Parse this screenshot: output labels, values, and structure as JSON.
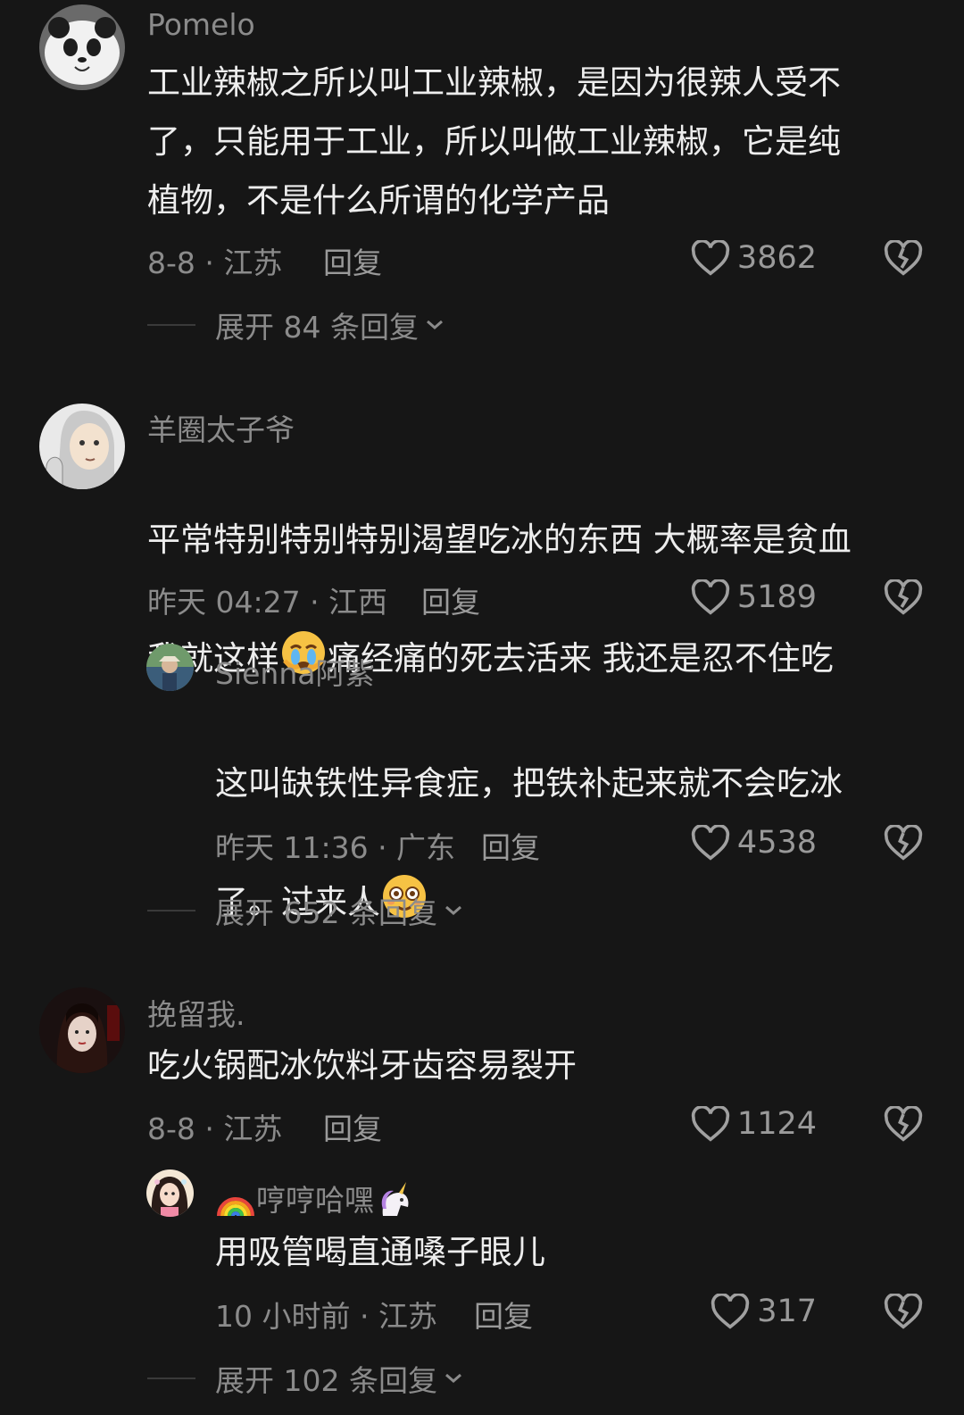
{
  "comments": [
    {
      "username": "Pomelo",
      "text": "工业辣椒之所以叫工业辣椒，是因为很辣人受不\n了，只能用于工业，所以叫做工业辣椒，它是纯\n植物，不是什么所谓的化学产品",
      "meta": "8-8 · 江苏",
      "reply": "回复",
      "likes": "3862",
      "expand": "展开 84 条回复"
    },
    {
      "username": "羊圈太子爷",
      "text_line1": "平常特别特别特别渴望吃冰的东西 大概率是贫血",
      "text_line2a": "我就这样",
      "text_line2b": "痛经痛的死去活来 我还是忍不住吃",
      "meta": "昨天 04:27 · 江西",
      "reply": "回复",
      "likes": "5189",
      "sub": {
        "username": "Sienna阿紫",
        "text_line1": "这叫缺铁性异食症，把铁补起来就不会吃冰",
        "text_line2": "了。过来人",
        "meta": "昨天 11:36 · 广东",
        "reply": "回复",
        "likes": "4538"
      },
      "expand": "展开 652 条回复"
    },
    {
      "username": "挽留我.",
      "text": "吃火锅配冰饮料牙齿容易裂开",
      "meta": "8-8 · 江苏",
      "reply": "回复",
      "likes": "1124",
      "sub": {
        "username": "哼哼哈嘿",
        "text": "用吸管喝直通嗓子眼儿",
        "meta": "10 小时前 · 江苏",
        "reply": "回复",
        "likes": "317"
      },
      "expand": "展开 102 条回复"
    }
  ],
  "icons": {
    "like": "heart-outline-icon",
    "dislike": "broken-heart-icon",
    "expand": "chevron-down-icon"
  },
  "colors": {
    "background": "#161616",
    "text": "#ededed",
    "muted": "#8b8b8b"
  }
}
